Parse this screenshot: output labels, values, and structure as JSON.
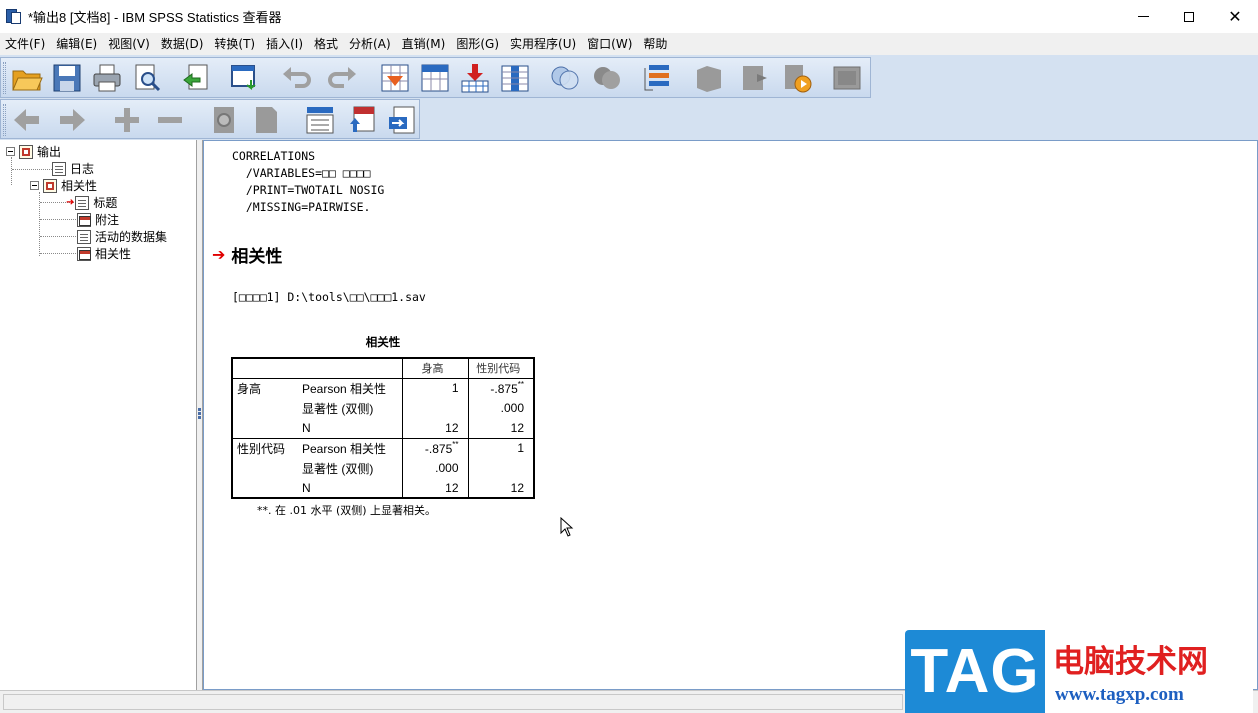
{
  "window": {
    "title": "*输出8 [文档8] - IBM SPSS Statistics 查看器",
    "minimize": "—",
    "close": "✕"
  },
  "menu": [
    "文件(F)",
    "编辑(E)",
    "视图(V)",
    "数据(D)",
    "转换(T)",
    "插入(I)",
    "格式",
    "分析(A)",
    "直销(M)",
    "图形(G)",
    "实用程序(U)",
    "窗口(W)",
    "帮助"
  ],
  "toolbar1_icons": [
    "open-folder-icon",
    "save-icon",
    "print-icon",
    "print-preview-icon",
    "export-icon",
    "recall-dialog-icon",
    "undo-icon",
    "redo-icon",
    "goto-case-icon",
    "goto-variable-icon",
    "insert-cases-icon",
    "insert-variable-icon",
    "variables-icon",
    "select-cases-icon",
    "weight-cases-icon",
    "value-labels-icon",
    "designate-window-icon",
    "output-block-icon",
    "use-sets-icon",
    "script-icon"
  ],
  "toolbar2_icons": [
    "promote-icon",
    "demote-icon",
    "expand-icon",
    "collapse-icon",
    "show-icon",
    "hide-icon",
    "insert-heading-icon",
    "insert-title-icon",
    "insert-text-icon"
  ],
  "tree": {
    "root": "输出",
    "log": "日志",
    "group": "相关性",
    "children": [
      "标题",
      "附注",
      "活动的数据集",
      "相关性"
    ]
  },
  "content": {
    "syntax": [
      "CORRELATIONS",
      "  /VARIABLES=□□ □□□□",
      "  /PRINT=TWOTAIL NOSIG",
      "  /MISSING=PAIRWISE."
    ],
    "heading": "相关性",
    "dataset_line": "[□□□□1] D:\\tools\\□□\\□□□1.sav",
    "table": {
      "title": "相关性",
      "col_headers": [
        "身高",
        "性别代码"
      ],
      "rows": [
        {
          "var": "身高",
          "cells": [
            {
              "stat": "Pearson 相关性",
              "v1": "1",
              "v2": "-.875"
            },
            {
              "stat": "显著性 (双侧)",
              "v1": "",
              "v2": ".000"
            },
            {
              "stat": "N",
              "v1": "12",
              "v2": "12"
            }
          ]
        },
        {
          "var": "性别代码",
          "cells": [
            {
              "stat": "Pearson 相关性",
              "v1": "-.875",
              "v2": "1"
            },
            {
              "stat": "显著性 (双侧)",
              "v1": ".000",
              "v2": ""
            },
            {
              "stat": "N",
              "v1": "12",
              "v2": "12"
            }
          ]
        }
      ],
      "sig_marker": "**",
      "footnote": "**. 在 .01 水平 (双侧) 上显著相关。"
    }
  },
  "watermark": {
    "tag": "TAG",
    "cn": "电脑技术网",
    "url": "www.tagxp.com",
    "blue": "#1d8ad6",
    "red": "#e02020"
  }
}
